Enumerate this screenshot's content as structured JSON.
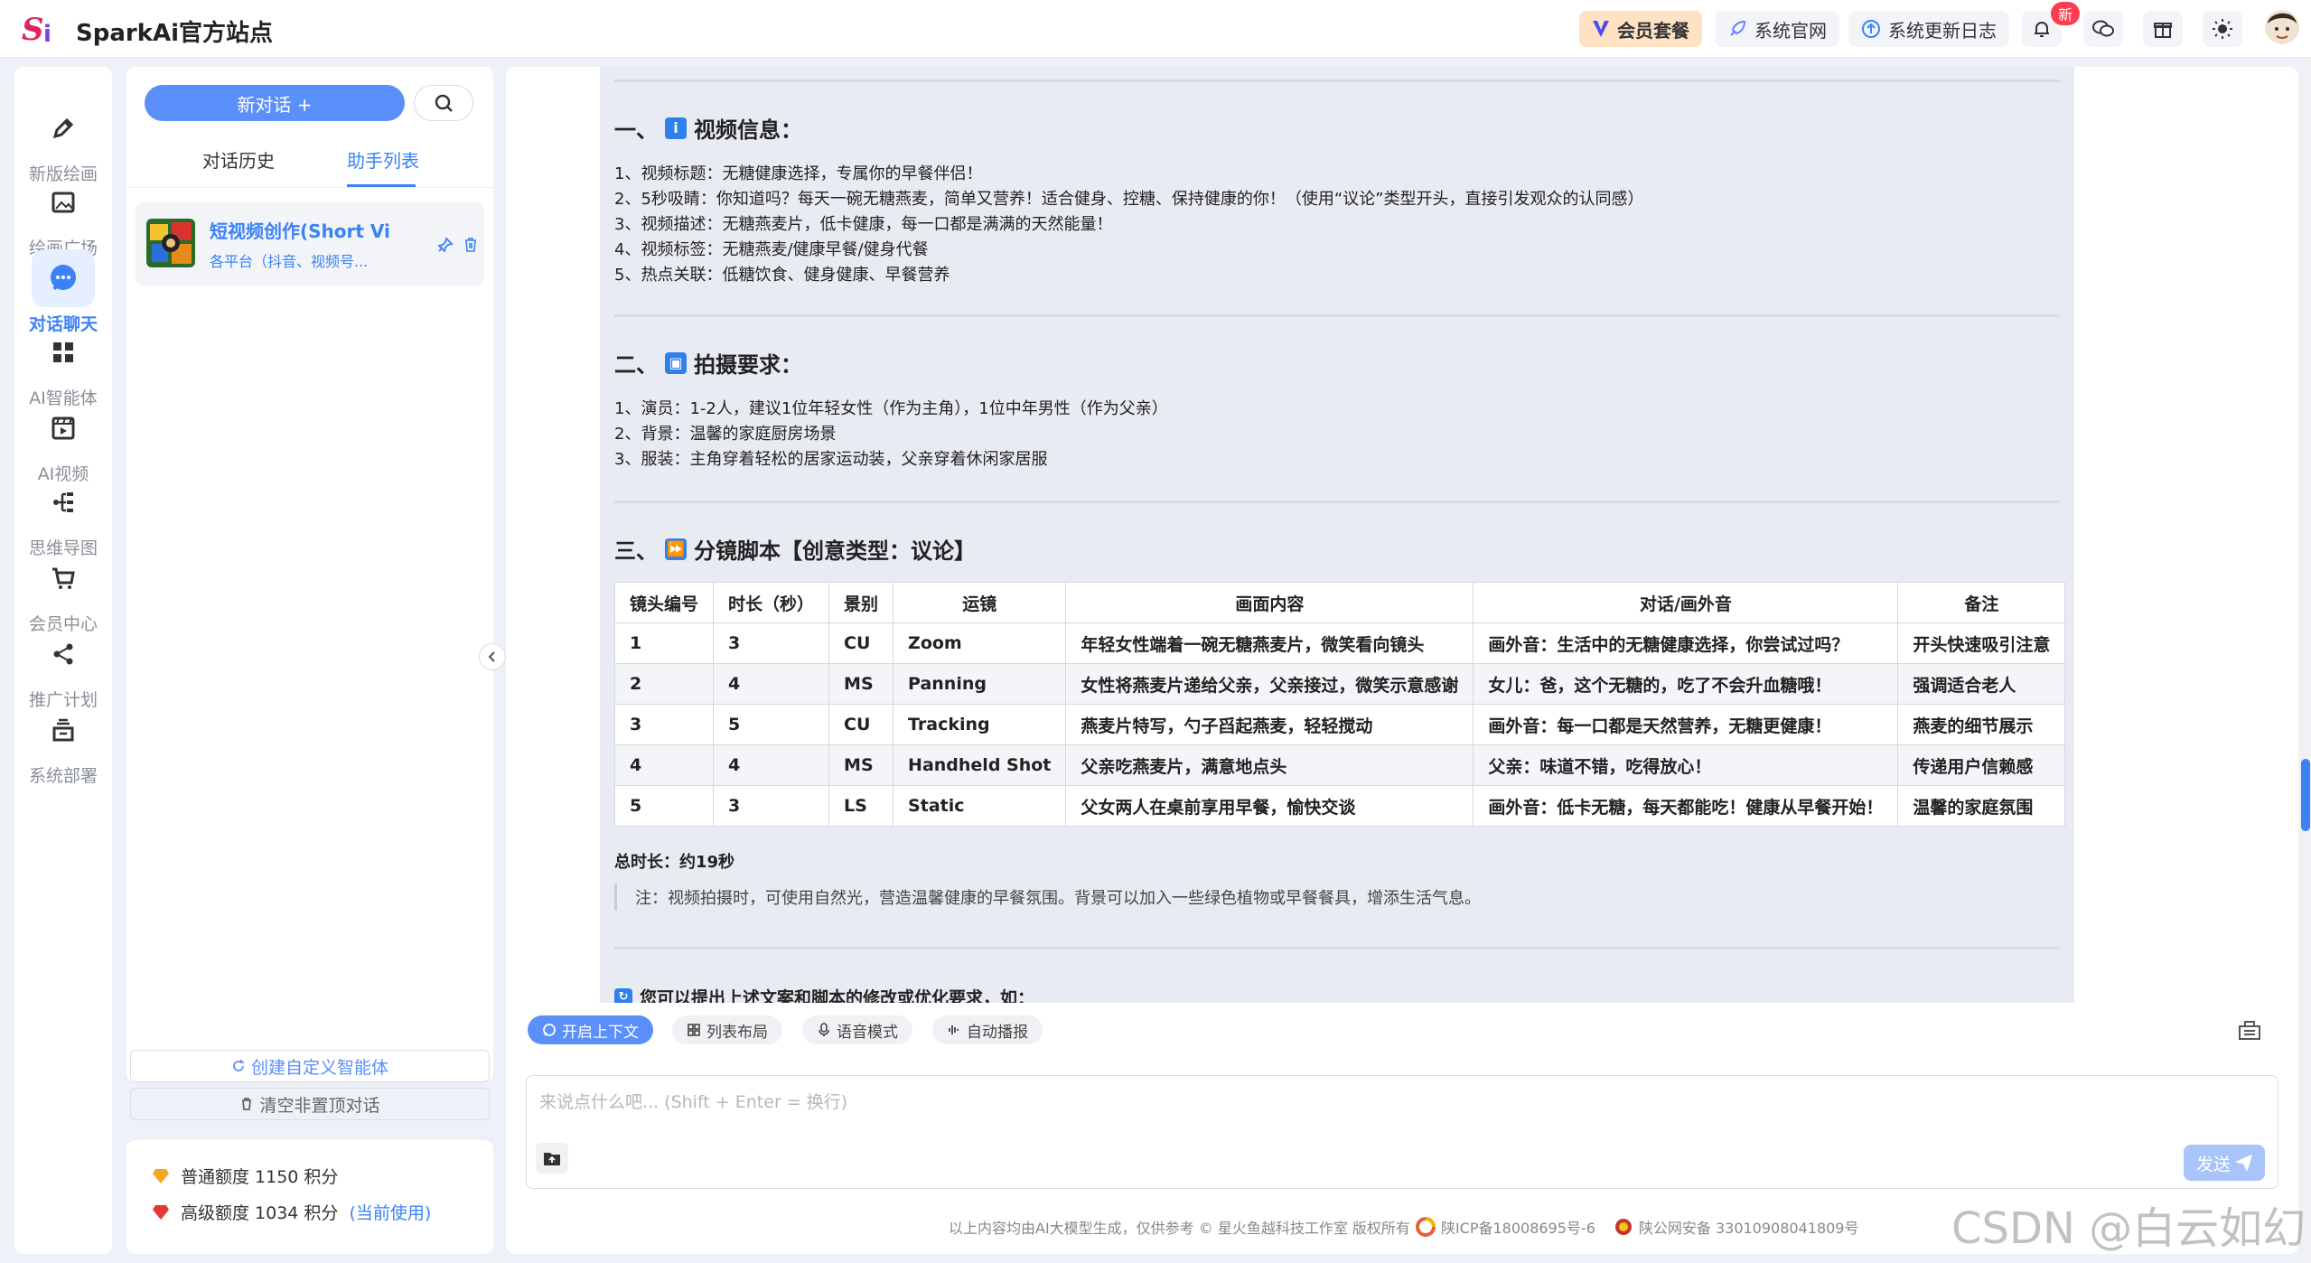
{
  "brand": {
    "name": "SparkAi官方站点",
    "logo_text": "Si"
  },
  "topbar": {
    "vip_label": "会员套餐",
    "site_label": "系统官网",
    "changelog_label": "系统更新日志",
    "notify_badge": "新"
  },
  "rail": {
    "items": [
      {
        "label": "新版绘画",
        "icon": "pen-icon"
      },
      {
        "label": "绘画广场",
        "icon": "image-icon"
      },
      {
        "label": "对话聊天",
        "icon": "chat-icon"
      },
      {
        "label": "AI智能体",
        "icon": "grid-icon"
      },
      {
        "label": "AI视频",
        "icon": "video-icon"
      },
      {
        "label": "思维导图",
        "icon": "mindmap-icon"
      },
      {
        "label": "会员中心",
        "icon": "cart-icon"
      },
      {
        "label": "推广计划",
        "icon": "share-icon"
      },
      {
        "label": "系统部署",
        "icon": "deploy-icon"
      }
    ]
  },
  "panel": {
    "new_chat": "新对话 +",
    "tabs": [
      "对话历史",
      "助手列表"
    ],
    "assistant": {
      "title": "短视频创作(Short Vide",
      "subtitle": "各平台（抖音、视频号..."
    },
    "create_agent": "创建自定义智能体",
    "clear_chats": "清空非置顶对话"
  },
  "quota": {
    "normal": "普通额度 1150 积分",
    "premium": "高级额度 1034 积分",
    "premium_link": "(当前使用)"
  },
  "content": {
    "s1_title": "一、ℹ️ 视频信息：",
    "s1_h": "一、",
    "s1_t": "视频信息：",
    "s1_lines": [
      "1、视频标题：无糖健康选择，专属你的早餐伴侣！",
      "2、5秒吸睛：你知道吗？每天一碗无糖燕麦，简单又营养！适合健身、控糖、保持健康的你！（使用“议论”类型开头，直接引发观众的认同感）",
      "3、视频描述：无糖燕麦片，低卡健康，每一口都是满满的天然能量！",
      "4、视频标签：无糖燕麦/健康早餐/健身代餐",
      "5、热点关联：低糖饮食、健身健康、早餐营养"
    ],
    "s2_h": "二、",
    "s2_t": "拍摄要求：",
    "s2_lines": [
      "1、演员：1-2人，建议1位年轻女性（作为主角），1位中年男性（作为父亲）",
      "2、背景：温馨的家庭厨房场景",
      "3、服装：主角穿着轻松的居家运动装，父亲穿着休闲家居服"
    ],
    "s3_h": "三、",
    "s3_t": "分镜脚本【创意类型：议论】",
    "table": {
      "headers": [
        "镜头编号",
        "时长（秒）",
        "景别",
        "运镜",
        "画面内容",
        "对话/画外音",
        "备注"
      ],
      "rows": [
        [
          "1",
          "3",
          "CU",
          "Zoom",
          "年轻女性端着一碗无糖燕麦片，微笑看向镜头",
          "画外音：生活中的无糖健康选择，你尝试过吗？",
          "开头快速吸引注意"
        ],
        [
          "2",
          "4",
          "MS",
          "Panning",
          "女性将燕麦片递给父亲，父亲接过，微笑示意感谢",
          "女儿：爸，这个无糖的，吃了不会升血糖哦！",
          "强调适合老人"
        ],
        [
          "3",
          "5",
          "CU",
          "Tracking",
          "燕麦片特写，勺子舀起燕麦，轻轻搅动",
          "画外音：每一口都是天然营养，无糖更健康！",
          "燕麦的细节展示"
        ],
        [
          "4",
          "4",
          "MS",
          "Handheld Shot",
          "父亲吃燕麦片，满意地点头",
          "父亲：味道不错，吃得放心！",
          "传递用户信赖感"
        ],
        [
          "5",
          "3",
          "LS",
          "Static",
          "父女两人在桌前享用早餐，愉快交谈",
          "画外音：低卡无糖，每天都能吃！健康从早餐开始！",
          "温馨的家庭氛围"
        ]
      ]
    },
    "total": "总时长：约19秒",
    "note": "注：视频拍摄时，可使用自然光，营造温馨健康的早餐氛围。背景可以加入一些绿色植物或早餐餐具，增添生活气息。",
    "ask": "您可以提出上述文案和脚本的修改或优化要求，如："
  },
  "toolbar": {
    "context": "开启上下文",
    "layout": "列表布局",
    "voice": "语音模式",
    "autoplay": "自动播报"
  },
  "input": {
    "placeholder": "来说点什么吧... (Shift + Enter = 换行)",
    "send": "发送"
  },
  "footer": {
    "disclaimer": "以上内容均由AI大模型生成，仅供参考 © 星火鱼越科技工作室 版权所有",
    "icp": "陕ICP备18008695号-6",
    "police": "陕公网安备 33010908041809号"
  },
  "watermark": "CSDN @白云如幻",
  "colors": {
    "accent": "#3b82f6",
    "button": "#5b8ff9",
    "vip": "#ffe2c4"
  }
}
